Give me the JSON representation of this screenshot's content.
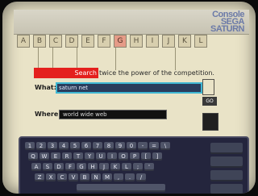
{
  "header": {
    "logo_top": "Console",
    "logo_main": "SEGA SATURN"
  },
  "nav": {
    "tabs": [
      "A",
      "B",
      "C",
      "D",
      "E",
      "F",
      "G",
      "H",
      "I",
      "J",
      "K",
      "L"
    ],
    "hot_index": 6
  },
  "search": {
    "button_label": "Search",
    "tagline": "twice the power of the competition.",
    "what_label": "What:",
    "what_value": "saturn net",
    "where_label": "Where:",
    "where_value": "world wide web",
    "side_button": "GO"
  },
  "keyboard": {
    "rows": [
      [
        "1",
        "2",
        "3",
        "4",
        "5",
        "6",
        "7",
        "8",
        "9",
        "0",
        "-",
        "=",
        "\\"
      ],
      [
        "Q",
        "W",
        "E",
        "R",
        "T",
        "Y",
        "U",
        "I",
        "O",
        "P",
        "[",
        "]"
      ],
      [
        "A",
        "S",
        "D",
        "F",
        "G",
        "H",
        "J",
        "K",
        "L",
        ";",
        "'"
      ],
      [
        "Z",
        "X",
        "C",
        "V",
        "B",
        "N",
        "M",
        ",",
        ".",
        "/"
      ]
    ],
    "space_label": ""
  }
}
